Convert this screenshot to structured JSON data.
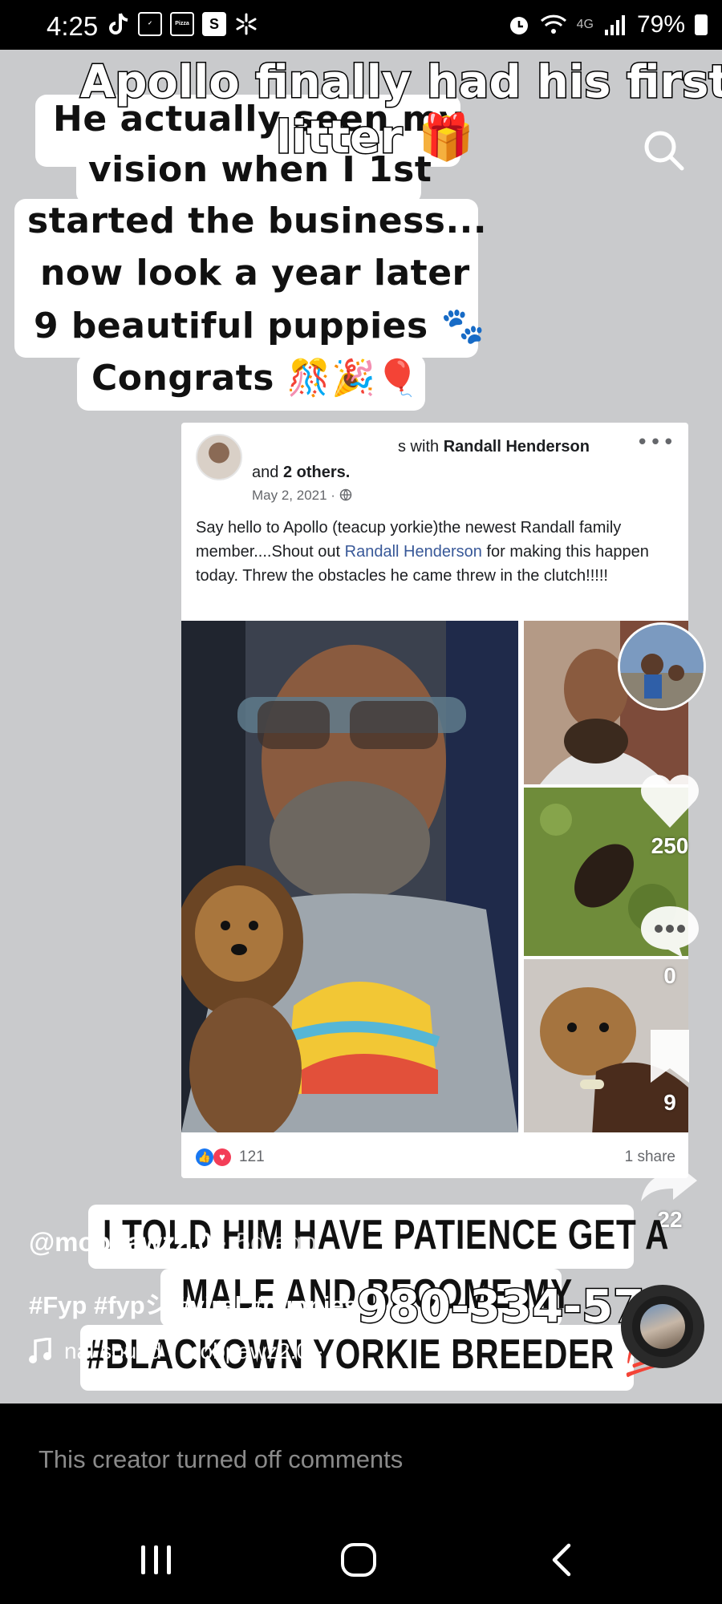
{
  "status_bar": {
    "time": "4:25",
    "network": "4G",
    "battery": "79%",
    "app_icons": [
      "tiktok-icon",
      "cricket-icon",
      "pizza-hut-icon",
      "s-app-icon",
      "walmart-icon"
    ],
    "pizza_icon_text": "Pizza Hut",
    "s_icon_text": "S"
  },
  "video": {
    "overlay_title_line1": "Apollo finally had his first",
    "overlay_title_line2": "litter 🎁",
    "caption_lines": [
      "He actually seen my",
      "vision when I 1st",
      "started the business...",
      "now look a year later",
      "9 beautiful puppies 🐾",
      "Congrats 🎊🎉🎈"
    ],
    "bottom_caption_lines": [
      "I TOLD HIM HAVE PATIENCE GET A",
      "MALE AND BECOME MY",
      "#BLACKOWN YORKIE BREEDER 💯"
    ],
    "phone_overlay": "980-334-575"
  },
  "fb_post": {
    "header_prefix": "s with",
    "tagged_name": "Randall Henderson",
    "and_prefix": "and",
    "others": "2 others.",
    "date": "May 2, 2021 ·",
    "more": "•••",
    "text_before_link": "Say hello to Apollo (teacup yorkie)the newest Randall family member....Shout out",
    "link_text": "Randall Henderson",
    "text_after_link": "for making this happen today. Threw the obstacles he came  threw in the clutch!!!!!",
    "reactions": "121",
    "shares": "1 share"
  },
  "rail": {
    "likes": "250",
    "comments": "0",
    "saves": "9",
    "shares": "22"
  },
  "info": {
    "username": "@mobpawz2.0",
    "time_ago": "· 5d ago",
    "hashtags": "#Fyp #fypシ #viral #puppies",
    "sound": "nal sound - mobpawz2.0 - "
  },
  "comments": {
    "disabled_text": "This creator turned off comments"
  },
  "colors": {
    "video_bg": "#c9cacc",
    "link_blue": "#385898",
    "fb_blue": "#1877f2",
    "love_red": "#f33e58"
  }
}
